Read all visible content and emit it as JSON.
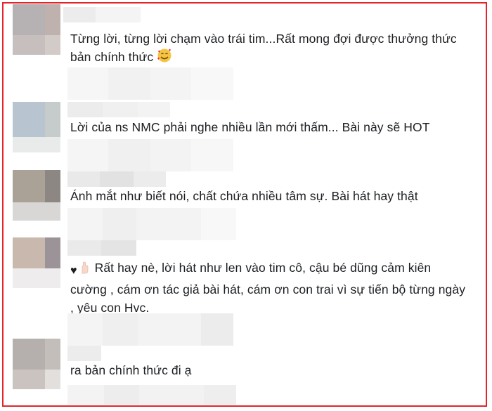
{
  "comments": [
    {
      "text": "Từng lời, từng lời chạm vào trái tim...Rất mong đợi được thưởng thức bản chính thức",
      "emoji_icon": "smiling-face-with-hearts-icon"
    },
    {
      "text": "Lời của ns NMC phải nghe nhiều lần mới thấm... Bài này sẽ HOT"
    },
    {
      "text": "Ánh mắt như biết nói, chất chứa nhiều tâm sự. Bài hát hay thật"
    },
    {
      "text": "Rất hay nè, lời hát như len vào tim cô, cậu bé dũng cảm kiên cường , cám ơn tác giả bài hát, cám ơn con trai vì sự tiến bộ từng ngày , yêu con Hvc.",
      "prefix_icons": [
        "black-heart-icon",
        "raised-hand-icon"
      ]
    },
    {
      "text": "ra bản chính thức đi ạ"
    }
  ],
  "colors": {
    "border": "#e2252b",
    "text": "#1c1e21"
  }
}
